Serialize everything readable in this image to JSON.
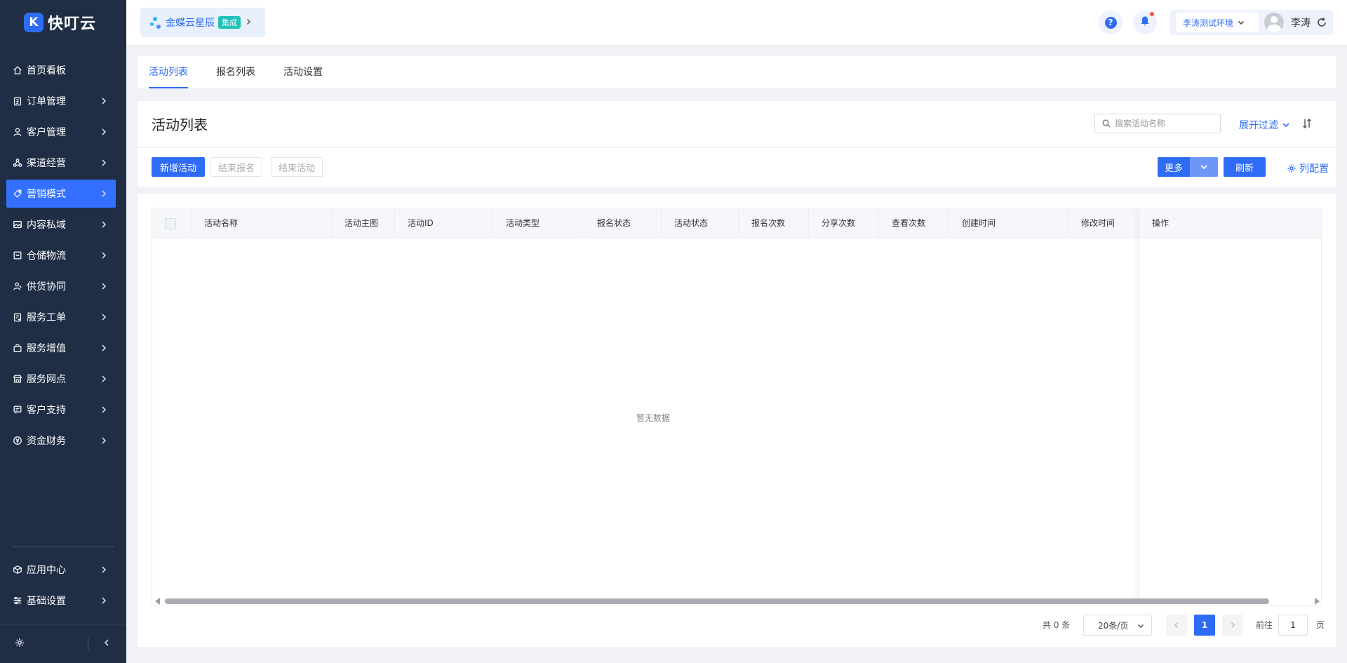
{
  "app": {
    "logo_mark": "K",
    "name": "快叮云"
  },
  "header": {
    "org": {
      "name": "金蝶云星辰",
      "badge": "集成"
    },
    "environment": "李涛测试环境",
    "user": "李涛"
  },
  "sidebar": {
    "items": [
      {
        "label": "首页看板",
        "icon": "home-icon"
      },
      {
        "label": "订单管理",
        "icon": "clipboard-icon"
      },
      {
        "label": "客户管理",
        "icon": "user-icon"
      },
      {
        "label": "渠道经营",
        "icon": "channel-icon"
      },
      {
        "label": "营销模式",
        "icon": "tag-icon",
        "active": true
      },
      {
        "label": "内容私域",
        "icon": "image-icon"
      },
      {
        "label": "仓储物流",
        "icon": "box-icon"
      },
      {
        "label": "供货协同",
        "icon": "partner-icon"
      },
      {
        "label": "服务工单",
        "icon": "ticket-icon"
      },
      {
        "label": "服务增值",
        "icon": "bag-icon"
      },
      {
        "label": "服务网点",
        "icon": "store-icon"
      },
      {
        "label": "客户支持",
        "icon": "support-icon"
      },
      {
        "label": "资金财务",
        "icon": "yen-icon"
      }
    ],
    "bottom_items": [
      {
        "label": "应用中心",
        "icon": "cube-icon"
      },
      {
        "label": "基础设置",
        "icon": "sliders-icon"
      }
    ]
  },
  "tabs": [
    {
      "label": "活动列表",
      "active": true
    },
    {
      "label": "报名列表"
    },
    {
      "label": "活动设置"
    }
  ],
  "main": {
    "title": "活动列表",
    "search_placeholder": "搜索活动名称",
    "expand_filter": "展开过滤",
    "toolbar": {
      "new_activity": "新增活动",
      "end_signup": "结束报名",
      "end_activity": "结束活动",
      "more": "更多",
      "refresh": "刷新",
      "column_config": "列配置"
    }
  },
  "table": {
    "columns": [
      "活动名称",
      "活动主图",
      "活动ID",
      "活动类型",
      "报名状态",
      "活动状态",
      "报名次数",
      "分享次数",
      "查看次数",
      "创建时间",
      "修改时间"
    ],
    "fixed_column": "操作",
    "empty_text": "暂无数据"
  },
  "pagination": {
    "total": "共 0 条",
    "page_size": "20条/页",
    "current_page": "1",
    "goto_label": "前往",
    "goto_value": "1",
    "page_unit": "页"
  },
  "colors": {
    "primary": "#2f6cf6",
    "sidebar_bg": "#1f2d45",
    "badge": "#1ec2b8"
  }
}
